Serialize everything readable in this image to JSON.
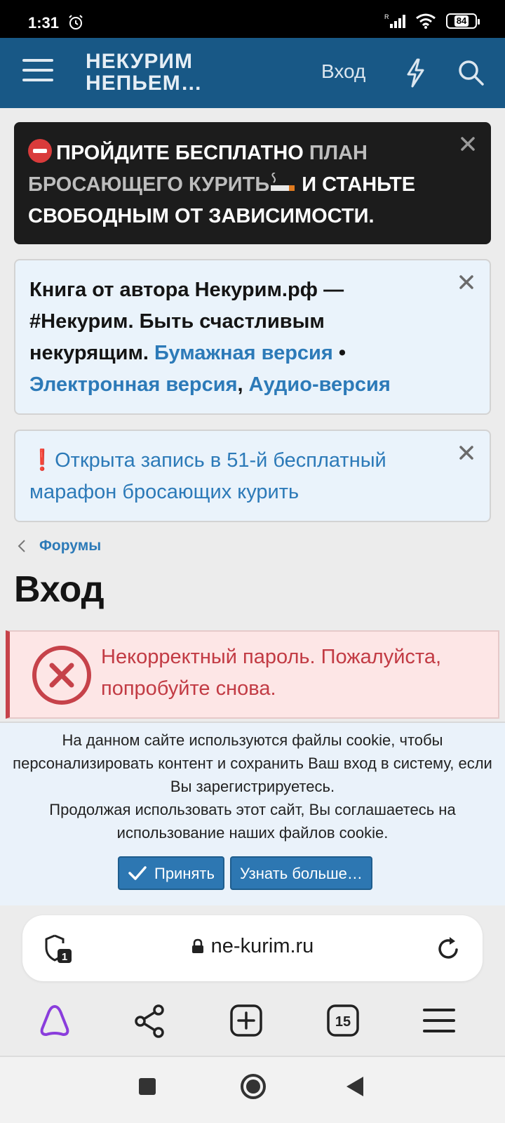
{
  "status_bar": {
    "time": "1:31",
    "battery": "84",
    "network": "R"
  },
  "header": {
    "logo_line1": "НЕКУРИМ",
    "logo_line2": "НЕПЬЕМ…",
    "login_label": "Вход",
    "color": "#185886"
  },
  "notices": {
    "promo": {
      "part1": "ПРОЙДИТЕ БЕСПЛАТНО",
      "part2": "ПЛАН БРОСАЮЩЕГО КУРИТЬ",
      "part3": "И СТАНЬТЕ СВОБОДНЫМ ОТ ЗАВИСИМОСТИ."
    },
    "book": {
      "text": "Книга от автора Некурим.рф — #Некурим. Быть счастливым некурящим.",
      "link_paper": "Бумажная версия",
      "separator": "•",
      "link_ebook": "Электронная версия",
      "comma": ",",
      "link_audio": "Аудио-версия"
    },
    "marathon": {
      "mark": "❗",
      "text": "Открыта запись в 51-й бесплатный марафон бросающих курить"
    }
  },
  "breadcrumb": {
    "label": "Форумы"
  },
  "page": {
    "title": "Вход"
  },
  "error": {
    "text": "Некорректный пароль. Пожалуйста, попробуйте снова."
  },
  "cookie": {
    "line1": "На данном сайте используются файлы cookie, чтобы персонализировать контент и сохранить Ваш вход в систему, если Вы зарегистрируетесь.",
    "line2": "Продолжая использовать этот сайт, Вы соглашаетесь на использование наших файлов cookie.",
    "accept_label": "Принять",
    "more_label": "Узнать больше…"
  },
  "browser": {
    "url": "ne-kurim.ru",
    "shield_count": "1",
    "tabs_count": "15"
  },
  "colors": {
    "accent": "#2c7ab8",
    "error": "#c23b44",
    "alice": "#8a3ddc"
  }
}
